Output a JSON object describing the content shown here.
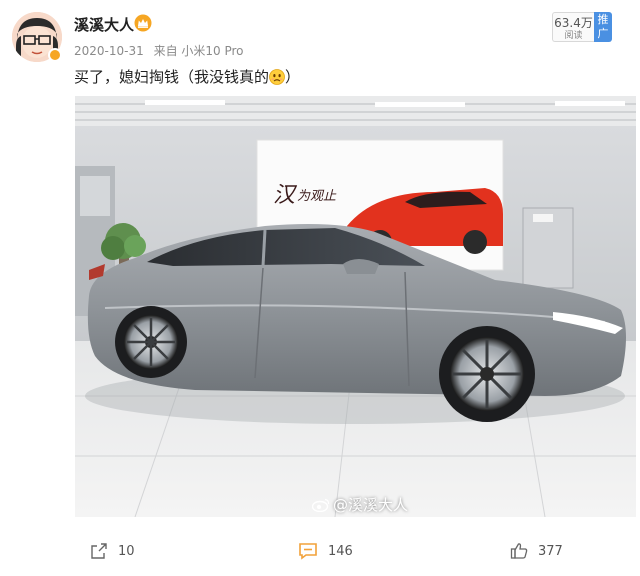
{
  "post": {
    "username": "溪溪大人",
    "date": "2020-10-31",
    "source": "来自 小米10 Pro",
    "text": "买了，媳妇掏钱（我没钱真的",
    "text_close": "）",
    "image_watermark": "@溪溪大人"
  },
  "stats": {
    "read_count": "63.4万",
    "read_label": "阅读",
    "promote_label": "推广"
  },
  "actions": {
    "share_count": "10",
    "comment_count": "146",
    "like_count": "377"
  },
  "colors": {
    "accent_orange": "#f6a623",
    "promote_blue": "#4a90e2",
    "comment_icon_orange": "#f2a23a"
  },
  "icons": {
    "crown": "crown-icon",
    "sad_emoji": "sad-face-icon",
    "share": "share-icon",
    "comment": "comment-icon",
    "like": "thumbs-up-icon",
    "weibo": "weibo-icon"
  }
}
